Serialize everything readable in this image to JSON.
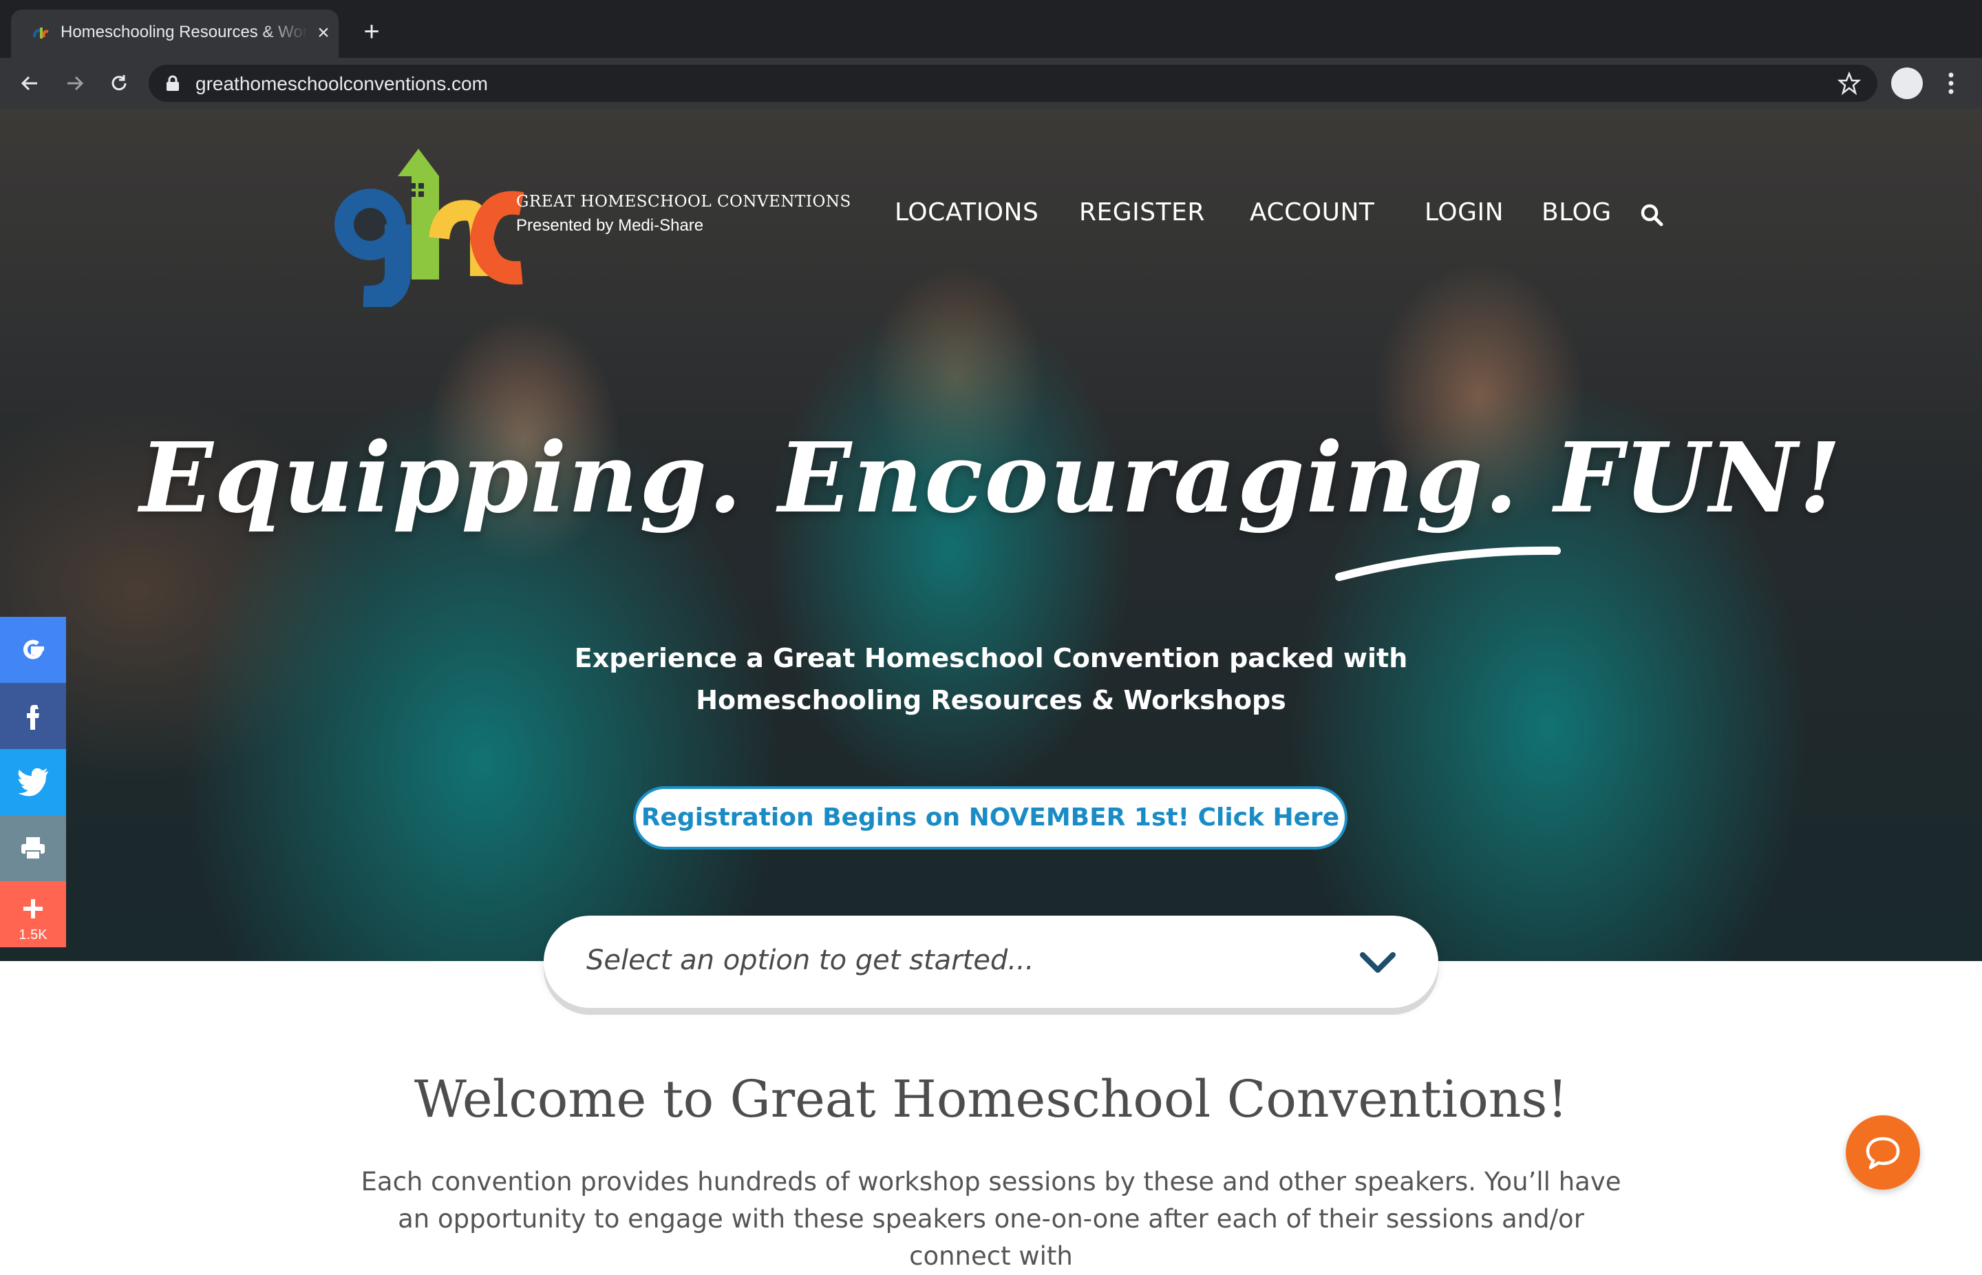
{
  "browser": {
    "tab_title": "Homeschooling Resources & Workshops",
    "url": "greathomeschoolconventions.com"
  },
  "site": {
    "logo_title": "GREAT HOMESCHOOL CONVENTIONS",
    "logo_subtitle": "Presented by Medi-Share",
    "nav": [
      "LOCATIONS",
      "REGISTER",
      "ACCOUNT",
      "LOGIN",
      "BLOG"
    ]
  },
  "hero": {
    "tagline": "Equipping. Encouraging. FUN!",
    "subtitle_line1": "Experience a Great Homeschool Convention packed with",
    "subtitle_line2": "Homeschooling Resources & Workshops",
    "cta_label": "Registration Begins on NOVEMBER 1st! Click Here"
  },
  "share": {
    "count": "1.5K",
    "buttons": [
      {
        "name": "google",
        "color": "#4285f4"
      },
      {
        "name": "facebook",
        "color": "#3b5998"
      },
      {
        "name": "twitter",
        "color": "#1da1f2"
      },
      {
        "name": "print",
        "color": "#6d8a96"
      },
      {
        "name": "more",
        "color": "#ff6550"
      }
    ]
  },
  "select": {
    "placeholder": "Select an option to get started..."
  },
  "content": {
    "heading": "Welcome to Great Homeschool Conventions!",
    "intro": "Each convention provides hundreds of workshop sessions by these and other speakers. You’ll have an opportunity to engage with these speakers one-on-one after each of their sessions and/or connect with"
  },
  "colors": {
    "accent_blue": "#1a8cc5",
    "chat_orange": "#f37021",
    "hero_teal": "#149696"
  }
}
